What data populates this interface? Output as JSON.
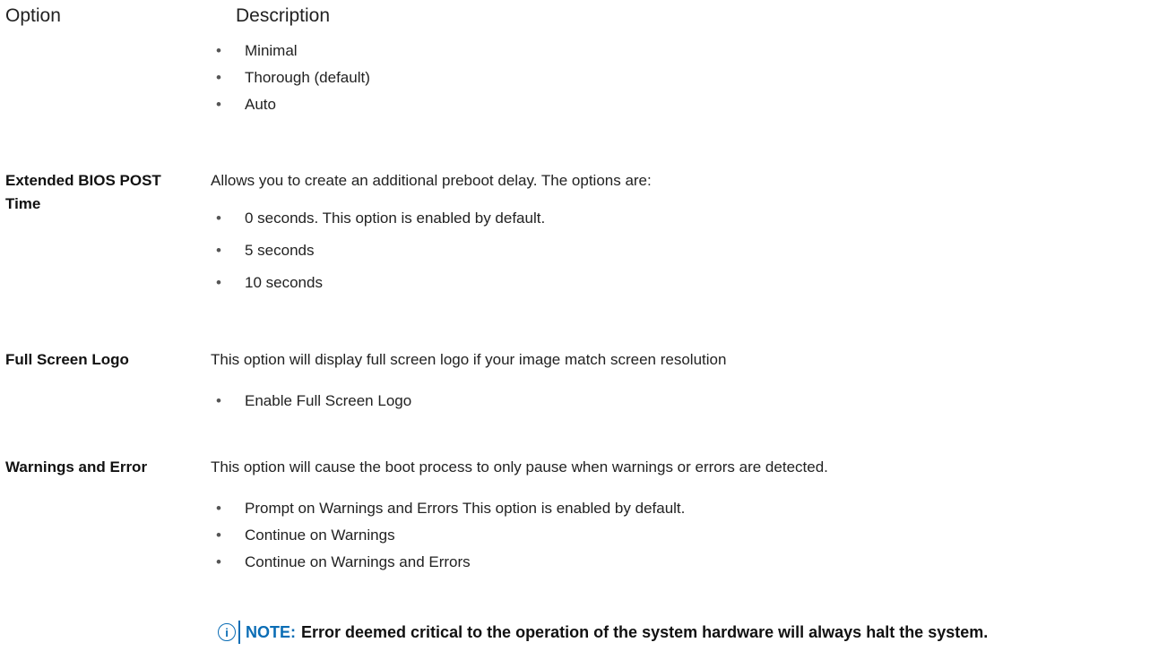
{
  "header": {
    "option": "Option",
    "description": "Description"
  },
  "first_list": [
    "Minimal",
    "Thorough (default)",
    "Auto"
  ],
  "extended_bios": {
    "name": "Extended BIOS POST Time",
    "description": "Allows you to create an additional preboot delay. The options are:",
    "items": [
      "0 seconds. This option is enabled by default.",
      "5 seconds",
      "10 seconds"
    ]
  },
  "full_screen_logo": {
    "name": "Full Screen Logo",
    "description": "This option will display full screen logo if your image match screen resolution",
    "items": [
      "Enable Full Screen Logo"
    ]
  },
  "warnings_error": {
    "name": "Warnings and Error",
    "description": "This option will cause the boot process to only pause when warnings or errors are detected.",
    "items": [
      "Prompt on Warnings and Errors This option is enabled by default.",
      "Continue on Warnings",
      "Continue on Warnings and Errors"
    ]
  },
  "note": {
    "icon": "info-icon",
    "label": "NOTE:",
    "text": "Error deemed critical to the operation of the system hardware will always halt the system.",
    "accent_color": "#0b6db5"
  }
}
